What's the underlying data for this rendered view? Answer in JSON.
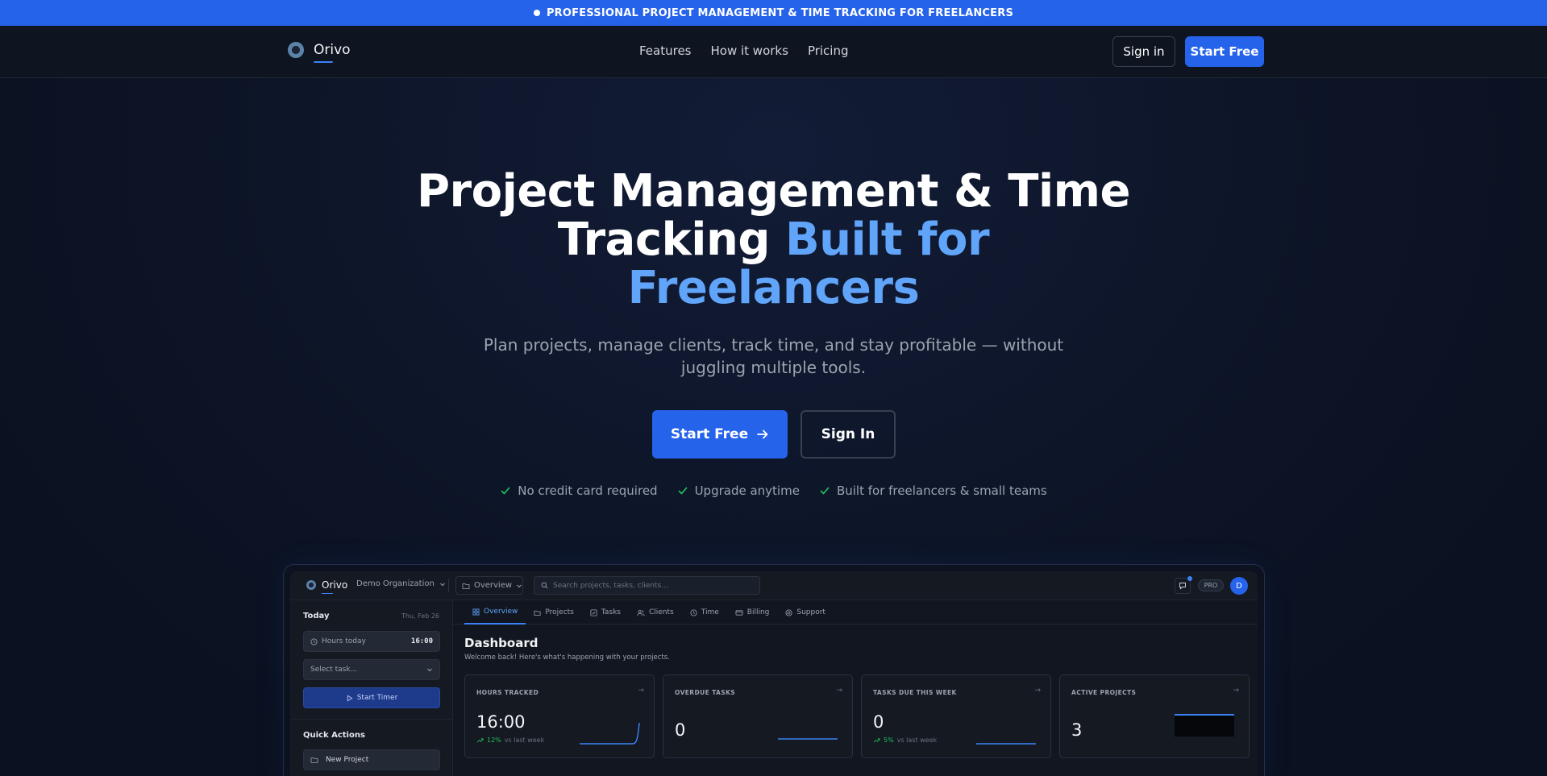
{
  "announcement": {
    "text": "PROFESSIONAL PROJECT MANAGEMENT & TIME TRACKING FOR FREELANCERS"
  },
  "nav": {
    "brand": "Orivo",
    "links": [
      "Features",
      "How it works",
      "Pricing"
    ],
    "signin_label": "Sign in",
    "start_label": "Start Free"
  },
  "hero": {
    "title_line1": "Project Management & Time",
    "title_line2_plain": "Tracking ",
    "title_line2_accent": "Built for",
    "title_line3_accent": "Freelancers",
    "subtitle": "Plan projects, manage clients, track time, and stay profitable — without juggling multiple tools.",
    "cta_primary": "Start Free",
    "cta_secondary": "Sign In",
    "checks": [
      "No credit card required",
      "Upgrade anytime",
      "Built for freelancers & small teams"
    ]
  },
  "colors": {
    "accent": "#2563eb",
    "accent_text": "#60a5fa",
    "success": "#22c55e",
    "background": "#0b1120"
  },
  "app_preview": {
    "brand": "Orivo",
    "org": "Demo Organization",
    "view": "Overview",
    "search_placeholder": "Search projects, tasks, clients...",
    "plan_badge": "PRO",
    "avatar_initial": "D",
    "sidebar": {
      "today_label": "Today",
      "date": "Thu, Feb 26",
      "hours_label": "Hours today",
      "hours_value": "16:00",
      "task_placeholder": "Select task...",
      "timer_label": "Start Timer",
      "quick_actions_label": "Quick Actions",
      "new_project_label": "New Project"
    },
    "tabs": [
      "Overview",
      "Projects",
      "Tasks",
      "Clients",
      "Time",
      "Billing",
      "Support"
    ],
    "active_tab": "Overview",
    "dashboard_title": "Dashboard",
    "dashboard_subtitle": "Welcome back! Here's what's happening with your projects.",
    "stats": [
      {
        "label": "HOURS TRACKED",
        "value": "16:00",
        "trend_pct": "12%",
        "trend_text": "vs last week"
      },
      {
        "label": "OVERDUE TASKS",
        "value": "0",
        "trend_pct": "",
        "trend_text": ""
      },
      {
        "label": "TASKS DUE THIS WEEK",
        "value": "0",
        "trend_pct": "5%",
        "trend_text": "vs last week"
      },
      {
        "label": "ACTIVE PROJECTS",
        "value": "3",
        "trend_pct": "",
        "trend_text": ""
      }
    ]
  }
}
